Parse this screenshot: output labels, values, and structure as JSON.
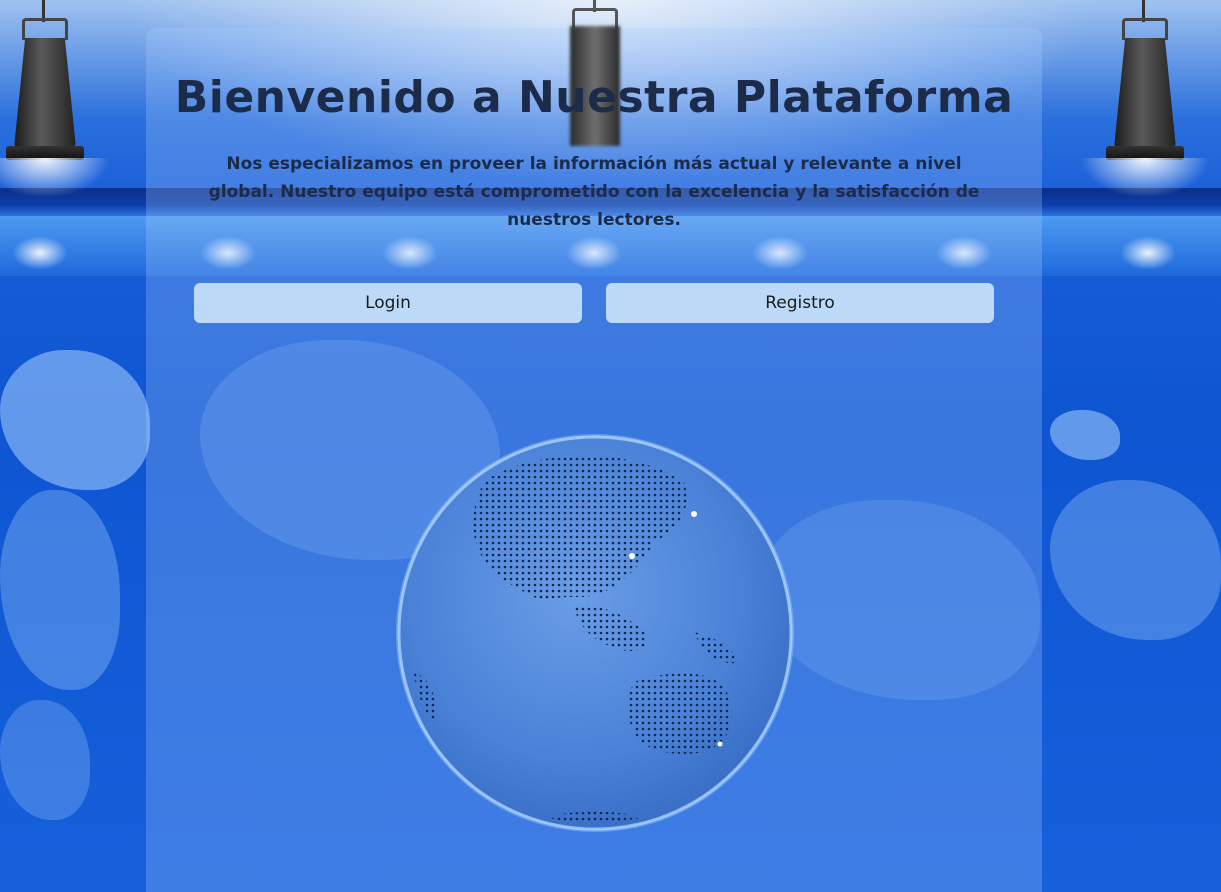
{
  "hero": {
    "title": "Bienvenido a Nuestra Plataforma",
    "description": "Nos especializamos en proveer la información más actual y relevante a nivel global. Nuestro equipo está comprometido con la excelencia y la satisfacción de nuestros lectores."
  },
  "actions": {
    "login_label": "Login",
    "register_label": "Registro"
  },
  "icons": {
    "globe": "globe-icon",
    "lamp": "spotlight-icon"
  },
  "colors": {
    "background": "#1660dc",
    "panel": "#aacdff",
    "button": "#bcdaf8",
    "text": "#1c2b4a",
    "globe": "#4a87dd"
  }
}
